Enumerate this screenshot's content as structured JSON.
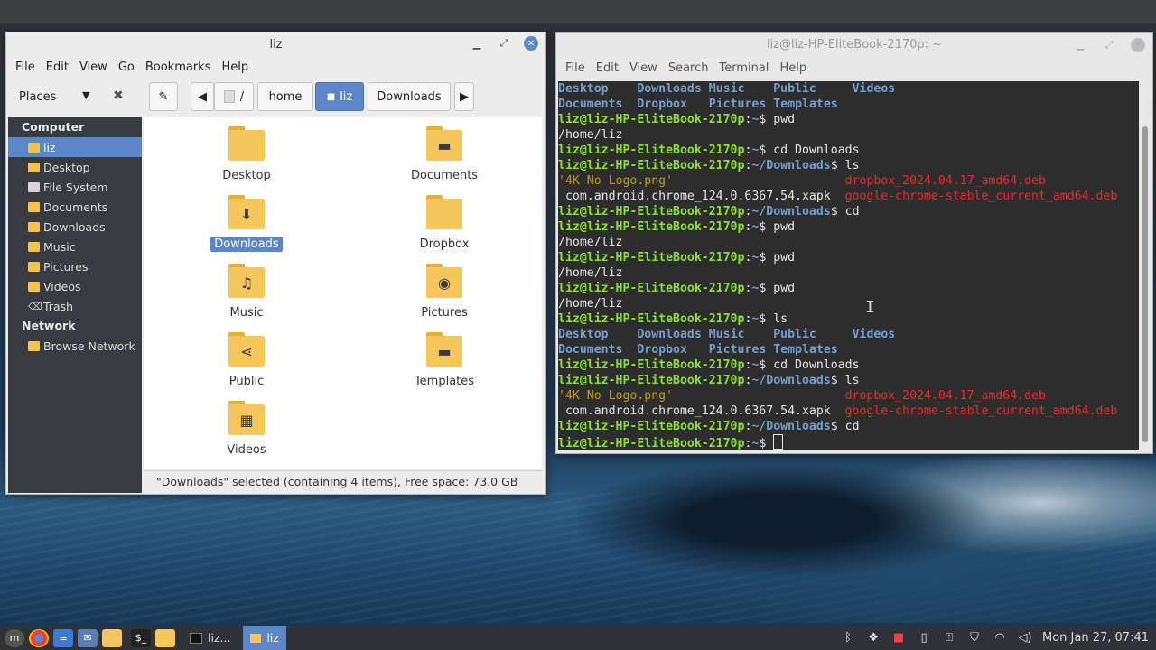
{
  "file_manager": {
    "title": "liz",
    "menu": [
      "File",
      "Edit",
      "View",
      "Go",
      "Bookmarks",
      "Help"
    ],
    "places_label": "Places",
    "path": {
      "root": "/",
      "home": "home",
      "current": "liz",
      "next": "Downloads"
    },
    "sidebar": {
      "computer_header": "Computer",
      "computer_items": [
        {
          "label": "liz",
          "icon": "home-folder-icon",
          "selected": true
        },
        {
          "label": "Desktop",
          "icon": "folder-icon"
        },
        {
          "label": "File System",
          "icon": "drive-icon"
        },
        {
          "label": "Documents",
          "icon": "documents-folder-icon"
        },
        {
          "label": "Downloads",
          "icon": "downloads-folder-icon"
        },
        {
          "label": "Music",
          "icon": "music-folder-icon"
        },
        {
          "label": "Pictures",
          "icon": "pictures-folder-icon"
        },
        {
          "label": "Videos",
          "icon": "videos-folder-icon"
        },
        {
          "label": "Trash",
          "icon": "trash-icon"
        }
      ],
      "network_header": "Network",
      "network_items": [
        {
          "label": "Browse Network",
          "icon": "network-folder-icon"
        }
      ]
    },
    "items": [
      {
        "label": "Desktop",
        "glyph": ""
      },
      {
        "label": "Documents",
        "glyph": "▬"
      },
      {
        "label": "Downloads",
        "glyph": "⬇",
        "selected": true
      },
      {
        "label": "Dropbox",
        "glyph": ""
      },
      {
        "label": "Music",
        "glyph": "♫"
      },
      {
        "label": "Pictures",
        "glyph": "◉"
      },
      {
        "label": "Public",
        "glyph": "⋖"
      },
      {
        "label": "Templates",
        "glyph": "▬"
      },
      {
        "label": "Videos",
        "glyph": "▦"
      }
    ],
    "status": "\"Downloads\" selected (containing 4 items), Free space: 73.0 GB"
  },
  "terminal": {
    "title": "liz@liz-HP-EliteBook-2170p: ~",
    "menu": [
      "File",
      "Edit",
      "View",
      "Search",
      "Terminal",
      "Help"
    ],
    "prompt_user": "liz@liz-HP-EliteBook-2170p",
    "lines": [
      {
        "t": "ls1",
        "a": "Desktop",
        "b": "Downloads",
        "c": "Music",
        "d": "Public",
        "e": "Videos"
      },
      {
        "t": "ls2",
        "a": "Documents",
        "b": "Dropbox",
        "c": "Pictures",
        "d": "Templates"
      },
      {
        "t": "cmd",
        "path": "~",
        "cmd": "pwd"
      },
      {
        "t": "out",
        "text": "/home/liz"
      },
      {
        "t": "cmd",
        "path": "~",
        "cmd": "cd Downloads"
      },
      {
        "t": "cmd",
        "path": "~/Downloads",
        "cmd": "ls"
      },
      {
        "t": "f1",
        "a": "'4K No Logo.png'",
        "b": "dropbox_2024.04.17_amd64.deb"
      },
      {
        "t": "f2",
        "a": " com.android.chrome_124.0.6367.54.xapk",
        "b": "google-chrome-stable_current_amd64.deb"
      },
      {
        "t": "cmd",
        "path": "~/Downloads",
        "cmd": "cd"
      },
      {
        "t": "cmd",
        "path": "~",
        "cmd": "pwd"
      },
      {
        "t": "out",
        "text": "/home/liz"
      },
      {
        "t": "cmd",
        "path": "~",
        "cmd": "pwd"
      },
      {
        "t": "out",
        "text": "/home/liz"
      },
      {
        "t": "cmd",
        "path": "~",
        "cmd": "pwd"
      },
      {
        "t": "out",
        "text": "/home/liz"
      },
      {
        "t": "cmd",
        "path": "~",
        "cmd": "ls"
      },
      {
        "t": "ls1",
        "a": "Desktop",
        "b": "Downloads",
        "c": "Music",
        "d": "Public",
        "e": "Videos"
      },
      {
        "t": "ls2",
        "a": "Documents",
        "b": "Dropbox",
        "c": "Pictures",
        "d": "Templates"
      },
      {
        "t": "cmd",
        "path": "~",
        "cmd": "cd Downloads"
      },
      {
        "t": "cmd",
        "path": "~/Downloads",
        "cmd": "ls"
      },
      {
        "t": "f1",
        "a": "'4K No Logo.png'",
        "b": "dropbox_2024.04.17_amd64.deb"
      },
      {
        "t": "f2",
        "a": " com.android.chrome_124.0.6367.54.xapk",
        "b": "google-chrome-stable_current_amd64.deb"
      },
      {
        "t": "cmd",
        "path": "~/Downloads",
        "cmd": "cd"
      },
      {
        "t": "cmd",
        "path": "~",
        "cmd": "",
        "cursor": true
      }
    ]
  },
  "taskbar": {
    "windows": [
      {
        "label": "liz...",
        "icon": "terminal-icon",
        "active": false
      },
      {
        "label": "liz",
        "icon": "folder-icon",
        "active": true
      }
    ],
    "clock": "Mon Jan 27, 07:41"
  },
  "colors": {
    "accent": "#5b86c7",
    "prompt": "#8ae234",
    "dir": "#729fcf",
    "deb": "#ef2929"
  }
}
